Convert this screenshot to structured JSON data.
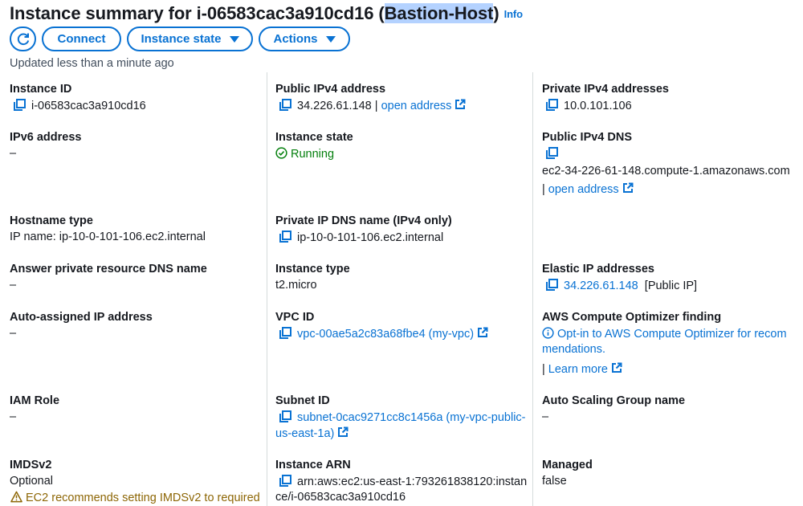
{
  "header": {
    "title_prefix": "Instance summary for i-06583cac3a910cd16 ",
    "title_highlight": "Bastion-Host",
    "title_suffix": ")",
    "title_paren": "(",
    "info_link": "Info"
  },
  "toolbar": {
    "connect": "Connect",
    "instance_state": "Instance state",
    "actions": "Actions"
  },
  "updated": "Updated less than a minute ago",
  "col1": {
    "instance_id_label": "Instance ID",
    "instance_id": "i-06583cac3a910cd16",
    "ipv6_label": "IPv6 address",
    "ipv6": "–",
    "hostname_type_label": "Hostname type",
    "hostname_type": "IP name: ip-10-0-101-106.ec2.internal",
    "answer_dns_label": "Answer private resource DNS name",
    "answer_dns": "–",
    "auto_ip_label": "Auto-assigned IP address",
    "auto_ip": "–",
    "iam_label": "IAM Role",
    "iam": "–",
    "imds_label": "IMDSv2",
    "imds": "Optional",
    "imds_warning": "EC2 recommends setting IMDSv2 to required"
  },
  "col2": {
    "public_ip_label": "Public IPv4 address",
    "public_ip": "34.226.61.148",
    "sep": " | ",
    "open_address": "open address",
    "state_label": "Instance state",
    "state": "Running",
    "private_dns_label": "Private IP DNS name (IPv4 only)",
    "private_dns": "ip-10-0-101-106.ec2.internal",
    "type_label": "Instance type",
    "type": "t2.micro",
    "vpc_label": "VPC ID",
    "vpc": "vpc-00ae5a2c83a68fbe4 (my-vpc)",
    "subnet_label": "Subnet ID",
    "subnet_line1": "subnet-0cac9271cc8c1456a (my-vpc-public-",
    "subnet_line2": "us-east-1a)",
    "arn_label": "Instance ARN",
    "arn_line1": "arn:aws:ec2:us-east-1:793261838120:instan",
    "arn_line2": "ce/i-06583cac3a910cd16"
  },
  "col3": {
    "private_ip_label": "Private IPv4 addresses",
    "private_ip": "10.0.101.106",
    "public_dns_label": "Public IPv4 DNS",
    "public_dns": "ec2-34-226-61-148.compute-1.amazonaws.com",
    "sep": "| ",
    "open_address": "open address",
    "eip_label": "Elastic IP addresses",
    "eip": "34.226.61.148",
    "eip_note": "[Public IP]",
    "optimizer_label": "AWS Compute Optimizer finding",
    "optimizer_line1": "Opt-in to AWS Compute Optimizer for recom",
    "optimizer_line2": "mendations.",
    "learn_more": "Learn more",
    "asg_label": "Auto Scaling Group name",
    "asg": "–",
    "managed_label": "Managed",
    "managed": "false"
  }
}
